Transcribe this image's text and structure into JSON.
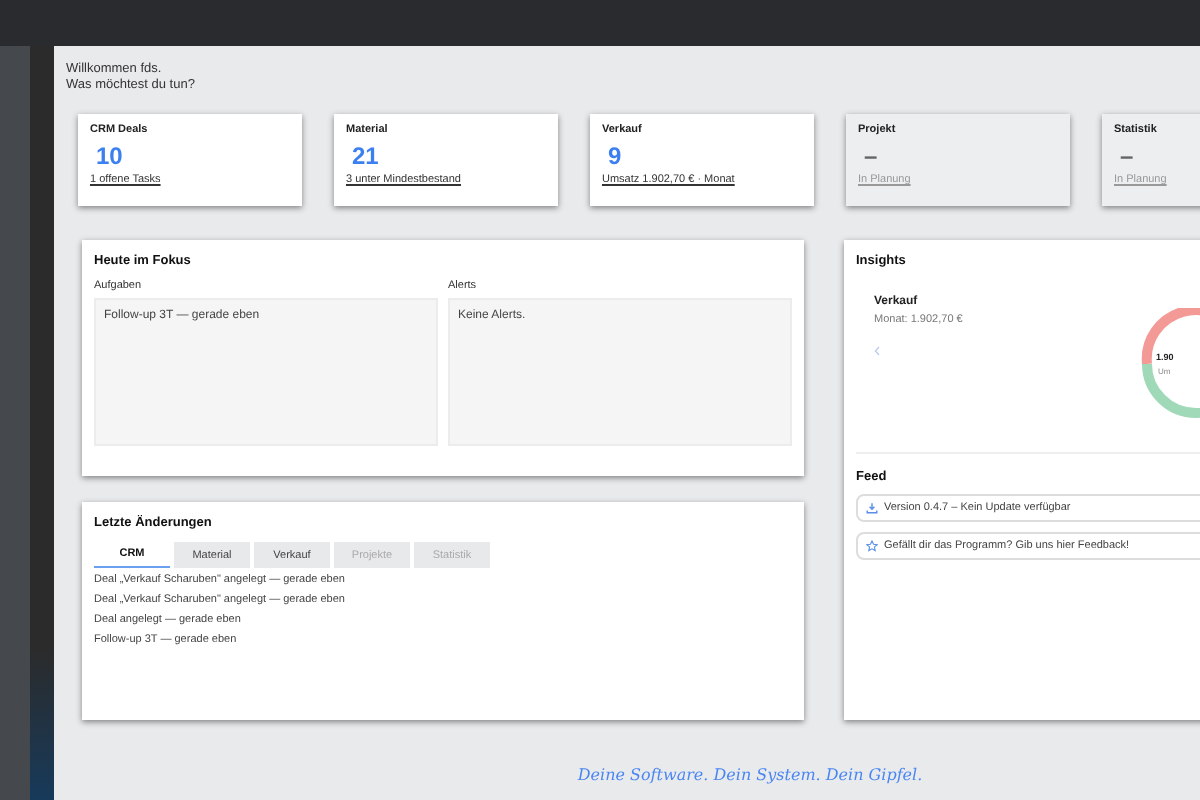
{
  "welcome": {
    "greeting": "Willkommen fds.",
    "question": "Was möchtest du tun?"
  },
  "cards": [
    {
      "title": "CRM Deals",
      "value": "10",
      "link": "1 offene Tasks",
      "disabled": false
    },
    {
      "title": "Material",
      "value": "21",
      "link": "3 unter Mindestbestand",
      "disabled": false
    },
    {
      "title": "Verkauf",
      "value": "9",
      "link": "Umsatz 1.902,70 € · Monat",
      "disabled": false
    },
    {
      "title": "Projekt",
      "value": "–",
      "link": "In Planung",
      "disabled": true
    },
    {
      "title": "Statistik",
      "value": "–",
      "link": "In Planung",
      "disabled": true
    }
  ],
  "focus": {
    "title": "Heute im Fokus",
    "columns": [
      {
        "heading": "Aufgaben",
        "items": [
          "Follow-up 3T — gerade eben"
        ]
      },
      {
        "heading": "Alerts",
        "items": [
          "Keine Alerts."
        ]
      }
    ]
  },
  "changes": {
    "title": "Letzte Änderungen",
    "tabs": [
      {
        "label": "CRM",
        "selected": true,
        "disabled": false
      },
      {
        "label": "Material",
        "selected": false,
        "disabled": false
      },
      {
        "label": "Verkauf",
        "selected": false,
        "disabled": false
      },
      {
        "label": "Projekte",
        "selected": false,
        "disabled": true
      },
      {
        "label": "Statistik",
        "selected": false,
        "disabled": true
      }
    ],
    "items": [
      "Deal „Verkauf Scharuben\" angelegt — gerade eben",
      "Deal „Verkauf Scharuben\" angelegt — gerade eben",
      "Deal angelegt — gerade eben",
      "Follow-up 3T — gerade eben"
    ]
  },
  "insights": {
    "title": "Insights",
    "slide": {
      "title": "Verkauf",
      "subtitle": "Monat: 1.902,70 €",
      "center_value": "1.90",
      "center_label": "Um"
    }
  },
  "feed": {
    "title": "Feed",
    "items": [
      {
        "kind": "download",
        "text": "Version 0.4.7 – Kein Update verfügbar"
      },
      {
        "kind": "star",
        "text": "Gefällt dir das Programm? Gib uns hier Feedback!"
      }
    ]
  },
  "tagline": "Deine Software. Dein System. Dein Gipfel."
}
